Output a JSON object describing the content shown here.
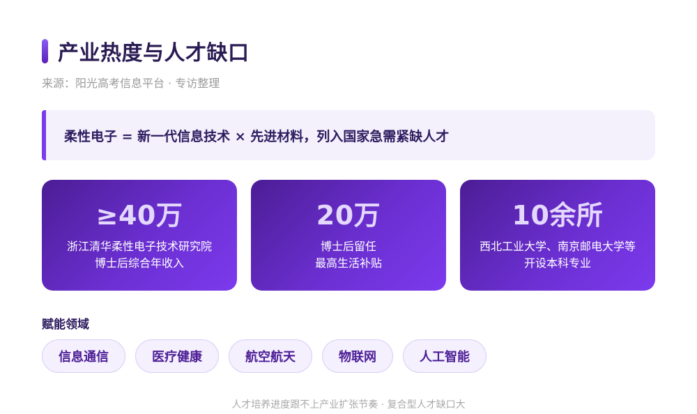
{
  "header": {
    "title": "产业热度与人才缺口",
    "source": "来源：阳光高考信息平台 · 专访整理"
  },
  "highlight": {
    "text": "柔性电子 = 新一代信息技术 × 先进材料，列入国家急需紧缺人才"
  },
  "stats": [
    {
      "value": "≥40万",
      "line1": "浙江清华柔性电子技术研究院",
      "line2": "博士后综合年收入"
    },
    {
      "value": "20万",
      "line1": "博士后留任",
      "line2": "最高生活补贴"
    },
    {
      "value": "10余所",
      "line1": "西北工业大学、南京邮电大学等",
      "line2": "开设本科专业"
    }
  ],
  "fields": {
    "label": "赋能领域",
    "tags": [
      "信息通信",
      "医疗健康",
      "航空航天",
      "物联网",
      "人工智能"
    ]
  },
  "footer": {
    "text": "人才培养进度跟不上产业扩张节奏 · 复合型人才缺口大"
  },
  "colors": {
    "accent": "#7c3aed",
    "card_gradient_start": "#4c1d95",
    "card_gradient_end": "#7c3aed",
    "title": "#2a1b53"
  }
}
